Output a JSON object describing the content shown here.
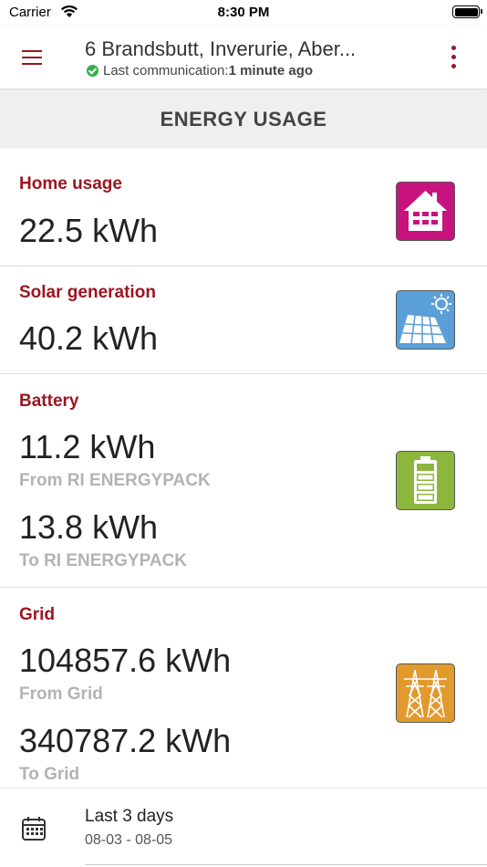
{
  "status_bar": {
    "carrier": "Carrier",
    "time": "8:30 PM"
  },
  "header": {
    "title": "6 Brandsbutt, Inverurie, Aber...",
    "subtitle_prefix": "Last communication:",
    "subtitle_value": "1 minute ago",
    "status_color": "#35b04a",
    "accent_color": "#9b1620"
  },
  "banner": {
    "title": "ENERGY USAGE"
  },
  "cards": {
    "home": {
      "title": "Home usage",
      "value": "22.5 kWh",
      "icon": "home-icon",
      "icon_color": "#c8137e"
    },
    "solar": {
      "title": "Solar generation",
      "value": "40.2 kWh",
      "icon": "solar-panel-icon",
      "icon_color": "#5b9fd9"
    },
    "battery": {
      "title": "Battery",
      "value_from": "11.2 kWh",
      "label_from": "From RI ENERGYPACK",
      "value_to": "13.8 kWh",
      "label_to": "To RI ENERGYPACK",
      "icon": "battery-icon",
      "icon_color": "#8db63d"
    },
    "grid": {
      "title": "Grid",
      "value_from": "104857.6 kWh",
      "label_from": "From Grid",
      "value_to": "340787.2 kWh",
      "label_to": "To Grid",
      "icon": "power-pylon-icon",
      "icon_color": "#e39a2d"
    }
  },
  "date_selector": {
    "label": "Last 3 days",
    "range": "08-03 - 08-05",
    "icon": "calendar-icon"
  }
}
